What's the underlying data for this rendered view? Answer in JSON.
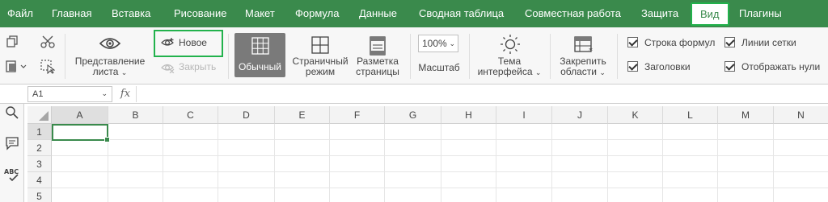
{
  "menu": {
    "items": [
      "Файл",
      "Главная",
      "Вставка",
      "Рисование",
      "Макет",
      "Формула",
      "Данные",
      "Сводная таблица",
      "Совместная работа",
      "Защита",
      "Вид",
      "Плагины"
    ],
    "active": "Вид"
  },
  "toolbar": {
    "view_label": "Представление",
    "view_label2": "листа",
    "new_label": "Новое",
    "close_label": "Закрыть",
    "normal_label": "Обычный",
    "page_mode_1": "Страничный",
    "page_mode_2": "режим",
    "page_layout_1": "Разметка",
    "page_layout_2": "страницы",
    "zoom_value": "100%",
    "zoom_label": "Масштаб",
    "theme_1": "Тема",
    "theme_2": "интерфейса",
    "freeze_1": "Закрепить",
    "freeze_2": "области",
    "formula_bar_label": "Строка формул",
    "headings_label": "Заголовки",
    "gridlines_label": "Линии сетки",
    "show_zeros_label": "Отображать нули"
  },
  "formula": {
    "cell_ref": "A1",
    "fx": "fx",
    "value": ""
  },
  "grid": {
    "columns": [
      "A",
      "B",
      "C",
      "D",
      "E",
      "F",
      "G",
      "H",
      "I",
      "J",
      "K",
      "L",
      "M",
      "N"
    ],
    "rows": [
      "1",
      "2",
      "3",
      "4",
      "5"
    ],
    "active_cell": "A1"
  },
  "colors": {
    "accent": "#3a8a4c",
    "highlight": "#22b24c"
  }
}
